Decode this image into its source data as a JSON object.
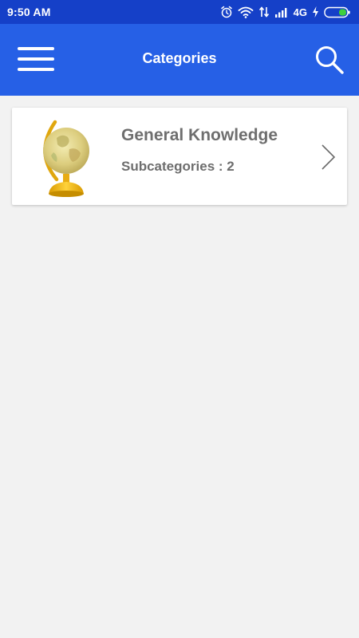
{
  "status_bar": {
    "time": "9:50 AM",
    "network": "4G",
    "icons": [
      "alarm-icon",
      "wifi-icon",
      "data-arrows-icon",
      "signal-icon",
      "charging-icon",
      "battery-icon"
    ]
  },
  "app_bar": {
    "title": "Categories",
    "menu_icon": "hamburger-menu-icon",
    "search_icon": "search-icon"
  },
  "categories": [
    {
      "title": "General Knowledge",
      "subtitle": "Subcategories : 2",
      "image": "globe-icon",
      "chevron": "chevron-right-icon"
    }
  ],
  "colors": {
    "status_bar": "#1540c8",
    "app_bar": "#2660e6",
    "background": "#f2f2f2",
    "card": "#ffffff",
    "card_text": "#6e6e6e",
    "battery_level": "#3ecf3e"
  }
}
